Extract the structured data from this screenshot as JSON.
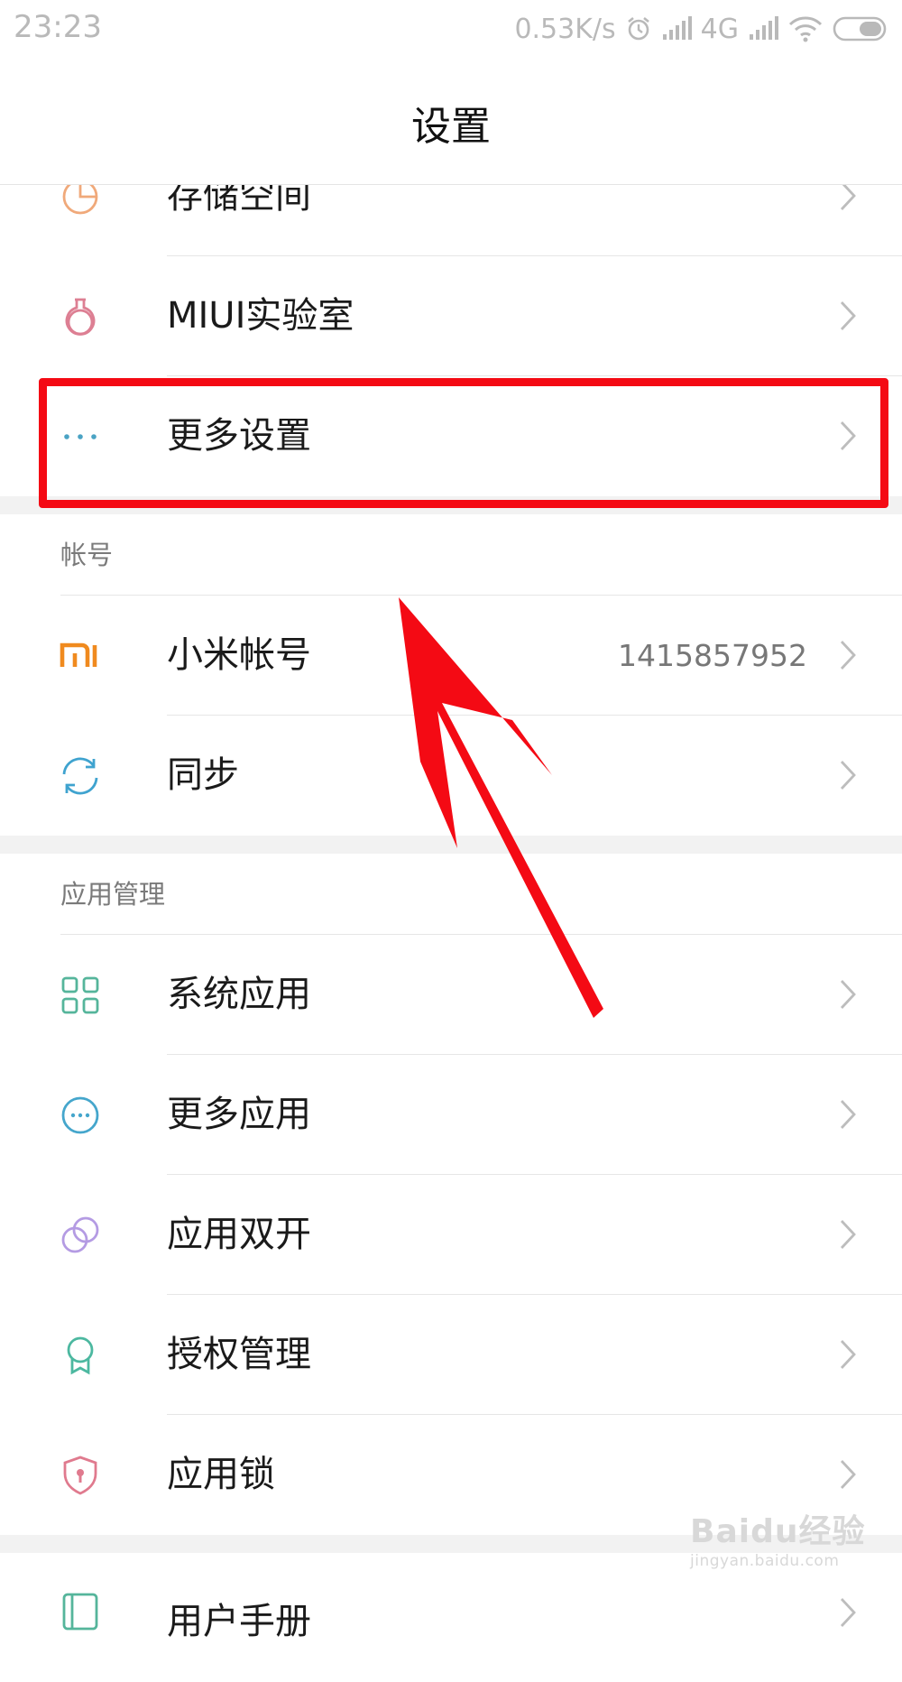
{
  "status_bar": {
    "time": "23:23",
    "net_speed": "0.53K/s",
    "network_type": "4G",
    "icons": [
      "alarm-icon",
      "signal-icon",
      "signal-icon",
      "wifi-icon",
      "battery-icon"
    ]
  },
  "page": {
    "title": "设置"
  },
  "rows_top": [
    {
      "label": "存储空间",
      "icon": "storage-icon",
      "color": "#f0a97a"
    },
    {
      "label": "MIUI实验室",
      "icon": "flask-icon",
      "color": "#dd7f93"
    },
    {
      "label": "更多设置",
      "icon": "more-dots-icon",
      "color": "#4aa3c4"
    }
  ],
  "sections": [
    {
      "header": "帐号",
      "rows": [
        {
          "label": "小米帐号",
          "value": "1415857952",
          "icon": "mi-logo-icon",
          "color": "#f08a1e"
        },
        {
          "label": "同步",
          "icon": "sync-icon",
          "color": "#3fa3cf"
        }
      ]
    },
    {
      "header": "应用管理",
      "rows": [
        {
          "label": "系统应用",
          "icon": "grid-apps-icon",
          "color": "#55b59b"
        },
        {
          "label": "更多应用",
          "icon": "more-apps-icon",
          "color": "#45a6cc"
        },
        {
          "label": "应用双开",
          "icon": "dual-apps-icon",
          "color": "#b49be3"
        },
        {
          "label": "授权管理",
          "icon": "permission-icon",
          "color": "#4cb8a0"
        },
        {
          "label": "应用锁",
          "icon": "app-lock-icon",
          "color": "#e07a8e"
        }
      ]
    }
  ],
  "bottom_partial_row": {
    "label": "用户手册",
    "icon": "manual-icon",
    "color": "#55b59b"
  },
  "annotation": {
    "highlight_color": "#f40a14",
    "highlighted_row": "更多设置"
  },
  "watermark": {
    "main": "Baidu经验",
    "sub": "jingyan.baidu.com"
  }
}
